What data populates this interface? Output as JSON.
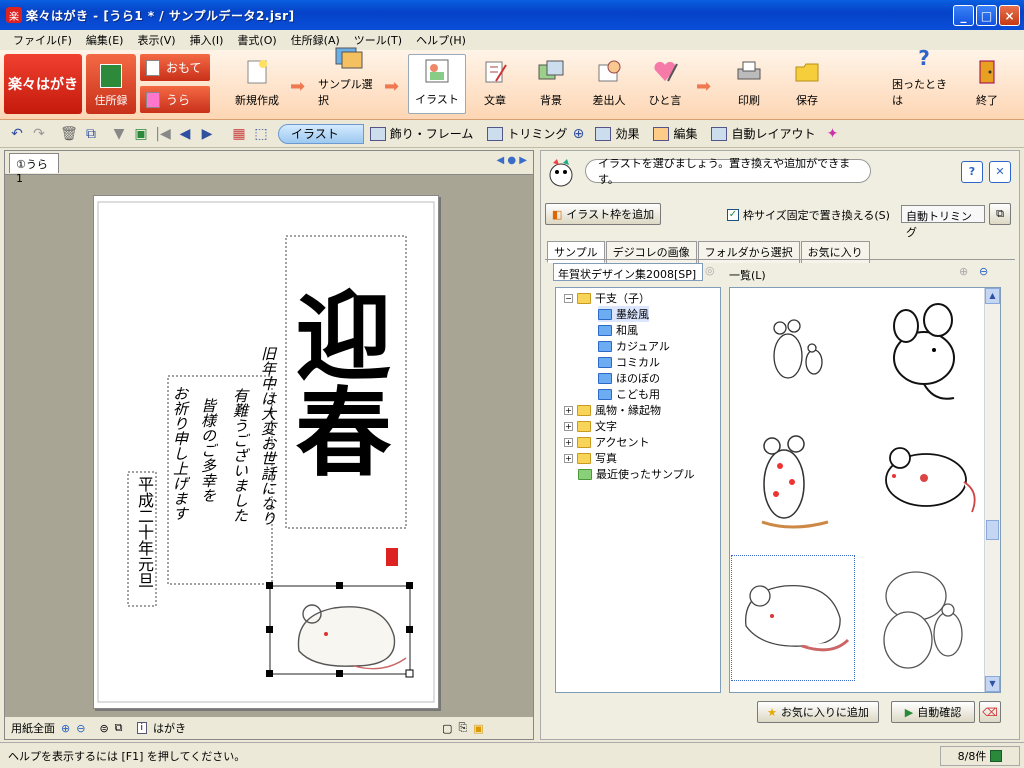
{
  "window": {
    "title": "楽々はがき - [うら1 * / サンプルデータ2.jsr]"
  },
  "menu": [
    "ファイル(F)",
    "編集(E)",
    "表示(V)",
    "挿入(I)",
    "書式(O)",
    "住所録(A)",
    "ツール(T)",
    "ヘルプ(H)"
  ],
  "ribbon": {
    "logo": "楽々はがき",
    "address_book": "住所録",
    "front": "おもて",
    "back": "うら",
    "tools": [
      {
        "label": "新規作成",
        "icon": "new-icon"
      },
      {
        "label": "サンプル選択",
        "icon": "sample-icon"
      },
      {
        "label": "イラスト",
        "icon": "illust-icon"
      },
      {
        "label": "文章",
        "icon": "text-icon"
      },
      {
        "label": "背景",
        "icon": "background-icon"
      },
      {
        "label": "差出人",
        "icon": "sender-icon"
      },
      {
        "label": "ひと言",
        "icon": "comment-icon"
      },
      {
        "label": "印刷",
        "icon": "print-icon"
      },
      {
        "label": "保存",
        "icon": "save-icon"
      },
      {
        "label": "困ったときは",
        "icon": "help-icon"
      },
      {
        "label": "終了",
        "icon": "exit-icon"
      }
    ]
  },
  "toolbar2": {
    "mode": "イラスト",
    "frame": "飾り・フレーム",
    "trimming": "トリミング",
    "effect": "効果",
    "edit": "編集",
    "autolayout": "自動レイアウト"
  },
  "left": {
    "tab": "①うら1",
    "bottom": {
      "zoom_label": "用紙全面",
      "paper_label": "はがき"
    },
    "card": {
      "big_text": "迎春",
      "message_col1": "旧年中は大変お世話になり",
      "message_col2": "有難うございました",
      "message_col3": "皆様のご多幸を",
      "message_col4": "お祈り申し上げます",
      "date_text": "平成二十年元旦"
    }
  },
  "right": {
    "hint": "イラストを選びましょう。置き換えや追加ができます。",
    "add_frame": "イラスト枠を追加",
    "fixed_size": "枠サイズ固定で置き換える(S)",
    "auto_trim": "自動トリミング",
    "tabs": [
      "サンプル",
      "デジコレの画像",
      "フォルダから選択",
      "お気に入り"
    ],
    "collection": "年賀状デザイン集2008[SP]",
    "list_label": "一覧(L)",
    "tree": [
      {
        "label": "干支（子）",
        "level": 0,
        "expanded": true,
        "folder": "yellow"
      },
      {
        "label": "墨絵風",
        "level": 1,
        "folder": "blue",
        "selected": true
      },
      {
        "label": "和風",
        "level": 1,
        "folder": "blue"
      },
      {
        "label": "カジュアル",
        "level": 1,
        "folder": "blue"
      },
      {
        "label": "コミカル",
        "level": 1,
        "folder": "blue"
      },
      {
        "label": "ほのぼの",
        "level": 1,
        "folder": "blue"
      },
      {
        "label": "こども用",
        "level": 1,
        "folder": "blue"
      },
      {
        "label": "風物・縁起物",
        "level": 0,
        "folder": "yellow"
      },
      {
        "label": "文字",
        "level": 0,
        "folder": "yellow"
      },
      {
        "label": "アクセント",
        "level": 0,
        "folder": "yellow"
      },
      {
        "label": "写真",
        "level": 0,
        "folder": "yellow"
      },
      {
        "label": "最近使ったサンプル",
        "level": 0,
        "folder": "green"
      }
    ],
    "favorite": "お気に入りに追加",
    "auto_confirm": "自動確認"
  },
  "status": {
    "help": "ヘルプを表示するには [F1] を押してください。",
    "count": "8/8件"
  }
}
